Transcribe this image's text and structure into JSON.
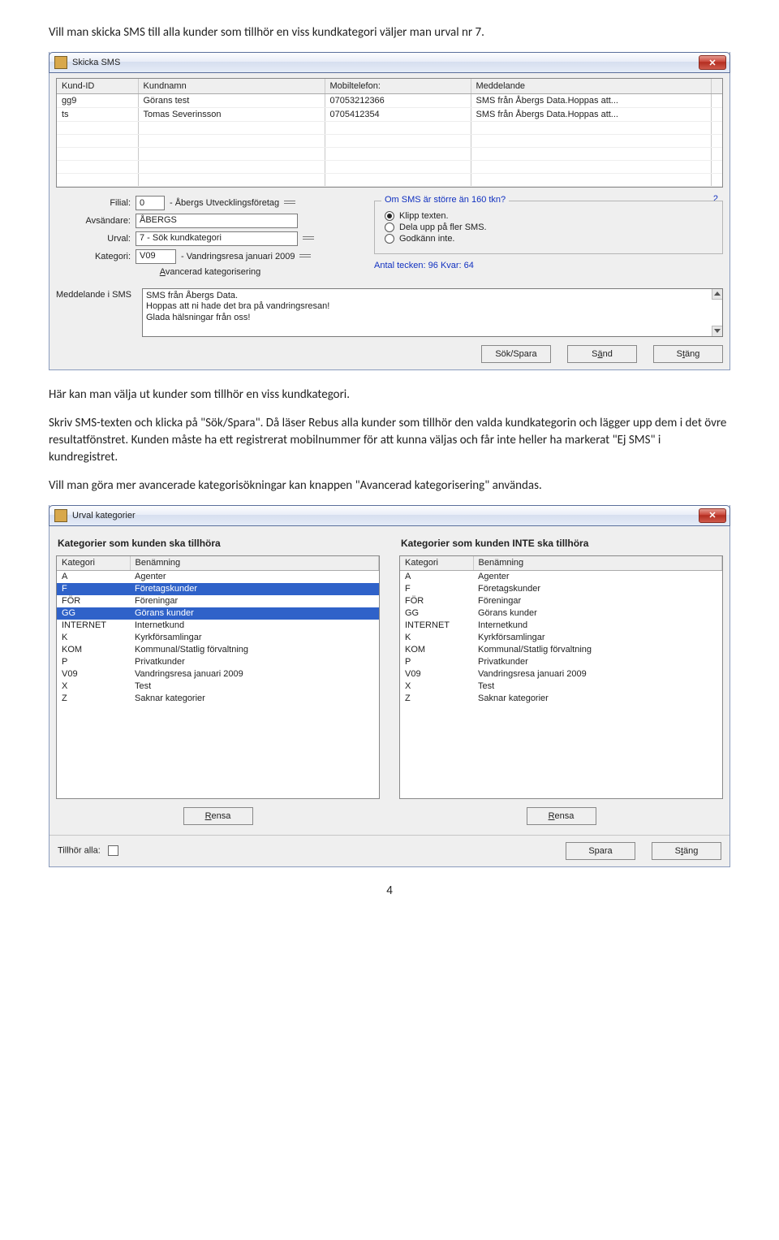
{
  "intro_text": "Vill man skicka SMS till alla kunder som tillhör en viss kundkategori väljer man urval nr 7.",
  "dialog1": {
    "title": "Skicka SMS",
    "table": {
      "headers": [
        "Kund-ID",
        "Kundnamn",
        "Mobiltelefon:",
        "Meddelande"
      ],
      "rows": [
        {
          "id": "gg9",
          "name": "Görans test",
          "mobile": "07053212366",
          "msg": "SMS från Åbergs Data.Hoppas att..."
        },
        {
          "id": "ts",
          "name": "Tomas Severinsson",
          "mobile": "0705412354",
          "msg": "SMS från Åbergs Data.Hoppas att..."
        }
      ]
    },
    "right_count": "2",
    "form": {
      "filial_lbl": "Filial:",
      "filial_code": "0",
      "filial_text": "- Åbergs Utvecklingsföretag",
      "avs_lbl": "Avsändare:",
      "avs_val": "ÅBERGS",
      "urval_lbl": "Urval:",
      "urval_val": "7 - Sök kundkategori",
      "kat_lbl": "Kategori:",
      "kat_code": "V09",
      "kat_text": "- Vandringsresa januari 2009",
      "adv_link": "Avancerad kategorisering"
    },
    "group": {
      "legend": "Om SMS är större än 160 tkn?",
      "opt1": "Klipp texten.",
      "opt2": "Dela upp på fler SMS.",
      "opt3": "Godkänn inte.",
      "count_info": "Antal tecken: 96 Kvar: 64"
    },
    "msg_lbl": "Meddelande i SMS",
    "msg_lines": [
      "SMS från Åbergs Data.",
      "Hoppas att ni hade det bra på vandringsresan!",
      "Glada hälsningar från oss!"
    ],
    "btn_sok": "Sök/Spara",
    "btn_sand_pre": "S",
    "btn_sand_ul": "ä",
    "btn_sand_post": "nd",
    "btn_stang_pre": "S",
    "btn_stang_ul": "t",
    "btn_stang_post": "äng"
  },
  "para1": "Här kan man välja ut kunder som tillhör en viss kundkategori.",
  "para2": "Skriv SMS-texten och klicka på \"Sök/Spara\". Då läser Rebus alla kunder som tillhör den valda kundkategorin och lägger upp dem i det övre resultatfönstret. Kunden måste ha ett registrerat mobilnummer för att kunna väljas och får inte heller ha markerat \"Ej SMS\" i kundregistret.",
  "para3": "Vill man göra mer avancerade kategorisökningar kan knappen \"Avancerad kategorisering\" användas.",
  "dialog2": {
    "title": "Urval kategorier",
    "left_head": "Kategorier som kunden ska tillhöra",
    "right_head": "Kategorier som kunden INTE ska tillhöra",
    "headers": [
      "Kategori",
      "Benämning"
    ],
    "items": [
      {
        "k": "A",
        "b": "Agenter"
      },
      {
        "k": "F",
        "b": "Företagskunder"
      },
      {
        "k": "FÖR",
        "b": "Föreningar"
      },
      {
        "k": "GG",
        "b": "Görans kunder"
      },
      {
        "k": "INTERNET",
        "b": "Internetkund"
      },
      {
        "k": "K",
        "b": "Kyrkförsamlingar"
      },
      {
        "k": "KOM",
        "b": "Kommunal/Statlig förvaltning"
      },
      {
        "k": "P",
        "b": "Privatkunder"
      },
      {
        "k": "V09",
        "b": "Vandringsresa januari 2009"
      },
      {
        "k": "X",
        "b": "Test"
      },
      {
        "k": "Z",
        "b": "Saknar kategorier"
      }
    ],
    "left_selected_keys": [
      "F",
      "GG"
    ],
    "rensa_label": "Rensa",
    "rensa_ul": "R",
    "rensa_post": "ensa",
    "tillhor_label": "Tillhör alla:",
    "spara_label": "Spara",
    "stang_pre": "S",
    "stang_ul": "t",
    "stang_post": "äng"
  },
  "page_number": "4"
}
